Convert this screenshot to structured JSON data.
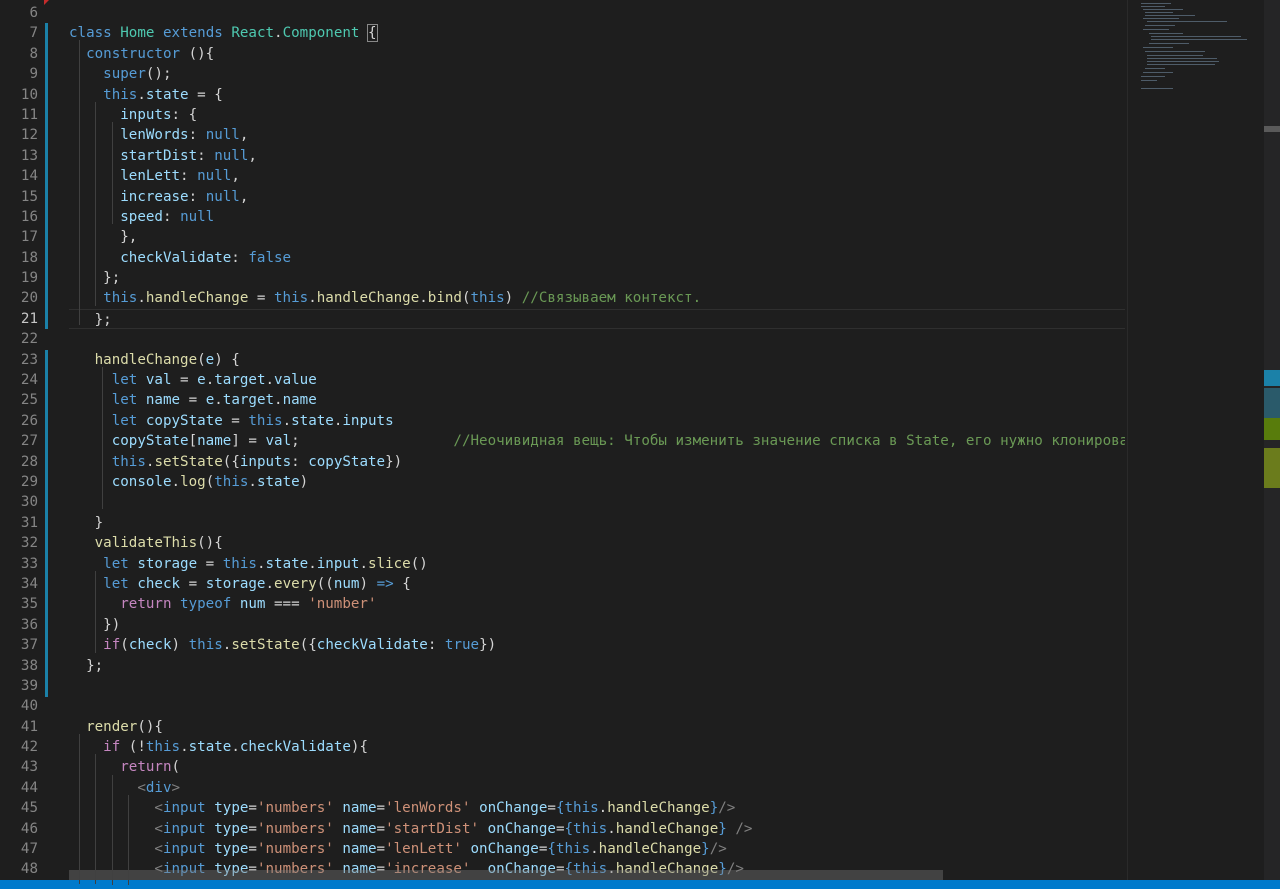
{
  "editor": {
    "language": "javascript",
    "active_line": 21,
    "lines": [
      {
        "n": "6",
        "html": ""
      },
      {
        "n": "7",
        "html": "<span class='k'>class</span> <span class='ty'>Home</span> <span class='k'>extends</span> <span class='ty'>React</span>.<span class='ty'>Component</span> <span class='br'>{</span>"
      },
      {
        "n": "8",
        "html": "  <span class='k'>constructor</span> (){"
      },
      {
        "n": "9",
        "html": "    <span class='k'>super</span>();"
      },
      {
        "n": "10",
        "html": "    <span class='k'>this</span>.<span class='p'>state</span> = {"
      },
      {
        "n": "11",
        "html": "      <span class='p'>inputs</span>: {"
      },
      {
        "n": "12",
        "html": "      <span class='p'>lenWords</span>: <span class='k'>null</span>,"
      },
      {
        "n": "13",
        "html": "      <span class='p'>startDist</span>: <span class='k'>null</span>,"
      },
      {
        "n": "14",
        "html": "      <span class='p'>lenLett</span>: <span class='k'>null</span>,"
      },
      {
        "n": "15",
        "html": "      <span class='p'>increase</span>: <span class='k'>null</span>,"
      },
      {
        "n": "16",
        "html": "      <span class='p'>speed</span>: <span class='k'>null</span>"
      },
      {
        "n": "17",
        "html": "      },"
      },
      {
        "n": "18",
        "html": "      <span class='p'>checkValidate</span>: <span class='k'>false</span>"
      },
      {
        "n": "19",
        "html": "    };"
      },
      {
        "n": "20",
        "html": "    <span class='k'>this</span>.<span class='f'>handleChange</span> = <span class='k'>this</span>.<span class='f'>handleChange</span>.<span class='f'>bind</span>(<span class='k'>this</span>) <span class='cm'>//Связываем контекст.</span>"
      },
      {
        "n": "21",
        "html": "   };"
      },
      {
        "n": "22",
        "html": ""
      },
      {
        "n": "23",
        "html": "   <span class='f'>handleChange</span>(<span class='p'>e</span>) {"
      },
      {
        "n": "24",
        "html": "     <span class='k'>let</span> <span class='p'>val</span> = <span class='p'>e</span>.<span class='p'>target</span>.<span class='p'>value</span>"
      },
      {
        "n": "25",
        "html": "     <span class='k'>let</span> <span class='p'>name</span> = <span class='p'>e</span>.<span class='p'>target</span>.<span class='p'>name</span>"
      },
      {
        "n": "26",
        "html": "     <span class='k'>let</span> <span class='p'>copyState</span> = <span class='k'>this</span>.<span class='p'>state</span>.<span class='p'>inputs</span>"
      },
      {
        "n": "27",
        "html": "     <span class='p'>copyState</span>[<span class='p'>name</span>] = <span class='p'>val</span>;                  <span class='cm'>//Неочивидная вещь: Чтобы изменить значение списка в State, его нужно клонировать и изменить</span>"
      },
      {
        "n": "28",
        "html": "     <span class='k'>this</span>.<span class='f'>setState</span>({<span class='p'>inputs</span>: <span class='p'>copyState</span>})"
      },
      {
        "n": "29",
        "html": "     <span class='p'>console</span>.<span class='f'>log</span>(<span class='k'>this</span>.<span class='p'>state</span>)"
      },
      {
        "n": "30",
        "html": ""
      },
      {
        "n": "31",
        "html": "   }"
      },
      {
        "n": "32",
        "html": "   <span class='f'>validateThis</span>(){"
      },
      {
        "n": "33",
        "html": "    <span class='k'>let</span> <span class='p'>storage</span> = <span class='k'>this</span>.<span class='p'>state</span>.<span class='p'>input</span>.<span class='f'>slice</span>()"
      },
      {
        "n": "34",
        "html": "    <span class='k'>let</span> <span class='p'>check</span> = <span class='p'>storage</span>.<span class='f'>every</span>((<span class='p'>num</span>) <span class='k'>=&gt;</span> {"
      },
      {
        "n": "35",
        "html": "      <span class='c'>return</span> <span class='k'>typeof</span> <span class='p'>num</span> === <span class='s'>'number'</span>"
      },
      {
        "n": "36",
        "html": "    })"
      },
      {
        "n": "37",
        "html": "    <span class='c'>if</span>(<span class='p'>check</span>) <span class='k'>this</span>.<span class='f'>setState</span>({<span class='p'>checkValidate</span>: <span class='k'>true</span>})"
      },
      {
        "n": "38",
        "html": "  };"
      },
      {
        "n": "39",
        "html": ""
      },
      {
        "n": "40",
        "html": ""
      },
      {
        "n": "41",
        "html": "  <span class='f'>render</span>(){"
      },
      {
        "n": "42",
        "html": "    <span class='c'>if</span> (!<span class='k'>this</span>.<span class='p'>state</span>.<span class='p'>checkValidate</span>){"
      },
      {
        "n": "43",
        "html": "      <span class='c'>return</span>("
      },
      {
        "n": "44",
        "html": "        <span class='t'>&lt;</span><span class='k'>div</span><span class='t'>&gt;</span>"
      },
      {
        "n": "45",
        "html": "          <span class='t'>&lt;</span><span class='k'>input</span> <span class='p'>type</span>=<span class='s'>'numbers'</span> <span class='p'>name</span>=<span class='s'>'lenWords'</span> <span class='p'>onChange</span>=<span class='k'>{</span><span class='k'>this</span>.<span class='f'>handleChange</span><span class='k'>}</span><span class='t'>/&gt;</span>"
      },
      {
        "n": "46",
        "html": "          <span class='t'>&lt;</span><span class='k'>input</span> <span class='p'>type</span>=<span class='s'>'numbers'</span> <span class='p'>name</span>=<span class='s'>'startDist'</span> <span class='p'>onChange</span>=<span class='k'>{</span><span class='k'>this</span>.<span class='f'>handleChange</span><span class='k'>}</span> <span class='t'>/&gt;</span>"
      },
      {
        "n": "47",
        "html": "          <span class='t'>&lt;</span><span class='k'>input</span> <span class='p'>type</span>=<span class='s'>'numbers'</span> <span class='p'>name</span>=<span class='s'>'lenLett'</span> <span class='p'>onChange</span>=<span class='k'>{</span><span class='k'>this</span>.<span class='f'>handleChange</span><span class='k'>}</span><span class='t'>/&gt;</span>"
      },
      {
        "n": "48",
        "html": "          <span class='t'>&lt;</span><span class='k'>input</span> <span class='p'>type</span>=<span class='s'>'numbers'</span> <span class='p'>name</span>=<span class='s'>'increase'</span>  <span class='p'>onChange</span>=<span class='k'>{</span><span class='k'>this</span>.<span class='f'>handleChange</span><span class='k'>}</span><span class='t'>/&gt;</span>"
      }
    ]
  },
  "colors": {
    "background": "#1e1e1e",
    "status_bar": "#007acc",
    "git_modified": "#1b81a8"
  }
}
